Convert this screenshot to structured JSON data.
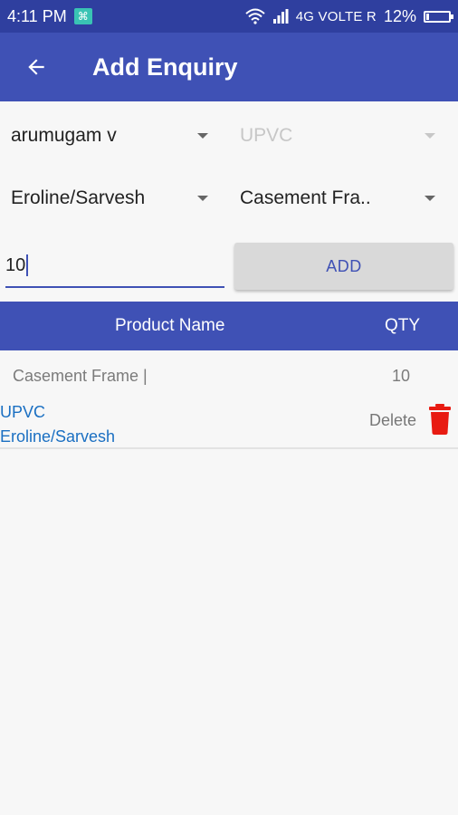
{
  "status_bar": {
    "time": "4:11 PM",
    "network_text": "4G VOLTE R",
    "battery_percent": "12%",
    "battery_level": 0.12,
    "icons": [
      "app-notification-icon",
      "wifi-icon",
      "signal-icon",
      "battery-icon"
    ]
  },
  "app_bar": {
    "title": "Add Enquiry",
    "back_icon": "arrow-left-icon"
  },
  "form": {
    "customer_spinner": "arumugam v",
    "material_spinner": "UPVC",
    "brand_spinner": "Eroline/Sarvesh",
    "product_spinner": "Casement Fra..",
    "quantity_value": "10",
    "add_button_label": "ADD"
  },
  "table": {
    "headers": {
      "product": "Product Name",
      "qty": "QTY"
    },
    "rows": [
      {
        "product": "Casement Frame |",
        "qty": "10",
        "line1": "UPVC",
        "line2": "Eroline/Sarvesh",
        "delete_label": "Delete"
      }
    ]
  },
  "colors": {
    "status_bar": "#2f3f9f",
    "primary": "#3f51b5",
    "link_text": "#1a6fc2",
    "delete_icon": "#e81b12",
    "button_bg": "#d9d9d9"
  }
}
